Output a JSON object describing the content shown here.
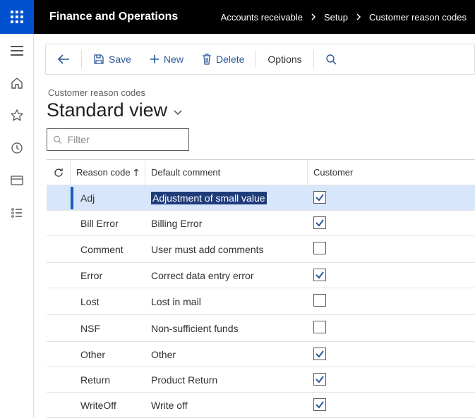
{
  "header": {
    "app_title": "Finance and Operations",
    "crumbs": [
      "Accounts receivable",
      "Setup",
      "Customer reason codes"
    ]
  },
  "actions": {
    "save": "Save",
    "new": "New",
    "delete": "Delete",
    "options": "Options"
  },
  "page": {
    "subtitle": "Customer reason codes",
    "view_label": "Standard view",
    "filter_placeholder": "Filter"
  },
  "grid": {
    "columns": {
      "code": "Reason code",
      "comment": "Default comment",
      "customer": "Customer"
    },
    "rows": [
      {
        "code": "Adj",
        "comment": "Adjustment of small value",
        "customer": true,
        "selected": true,
        "highlight_comment": true
      },
      {
        "code": "Bill Error",
        "comment": "Billing Error",
        "customer": true,
        "selected": false,
        "highlight_comment": false
      },
      {
        "code": "Comment",
        "comment": "User must add comments",
        "customer": false,
        "selected": false,
        "highlight_comment": false
      },
      {
        "code": "Error",
        "comment": "Correct data entry error",
        "customer": true,
        "selected": false,
        "highlight_comment": false
      },
      {
        "code": "Lost",
        "comment": "Lost in mail",
        "customer": false,
        "selected": false,
        "highlight_comment": false
      },
      {
        "code": "NSF",
        "comment": "Non-sufficient funds",
        "customer": false,
        "selected": false,
        "highlight_comment": false
      },
      {
        "code": "Other",
        "comment": "Other",
        "customer": true,
        "selected": false,
        "highlight_comment": false
      },
      {
        "code": "Return",
        "comment": "Product Return",
        "customer": true,
        "selected": false,
        "highlight_comment": false
      },
      {
        "code": "WriteOff",
        "comment": "Write off",
        "customer": true,
        "selected": false,
        "highlight_comment": false
      }
    ]
  }
}
